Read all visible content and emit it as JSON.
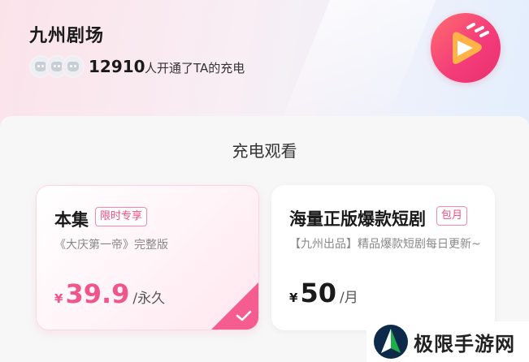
{
  "header": {
    "title": "九州剧场",
    "supporter_count": "12910",
    "supporter_text": "人开通了TA的充电"
  },
  "section": {
    "title": "充电观看"
  },
  "plans": [
    {
      "name": "本集",
      "tag": "限时专享",
      "description": "《大庆第一帝》完整版",
      "currency": "¥",
      "price": "39.9",
      "unit": "/永久",
      "selected": true
    },
    {
      "name": "海量正版爆款短剧",
      "tag": "包月",
      "description": "【九州出品】精品爆款短剧每日更新~",
      "currency": "¥",
      "price": "50",
      "unit": "/月",
      "selected": false
    }
  ],
  "watermark": {
    "text": "极限手游网"
  },
  "icons": {
    "logo": "play-logo-icon",
    "avatar": "avatar-placeholder-icon",
    "check": "check-icon"
  },
  "colors": {
    "accent": "#f2558a",
    "tag_border": "#f48aa8",
    "header_gradient_start": "#fbe3ea",
    "header_gradient_end": "#e3eefc"
  }
}
